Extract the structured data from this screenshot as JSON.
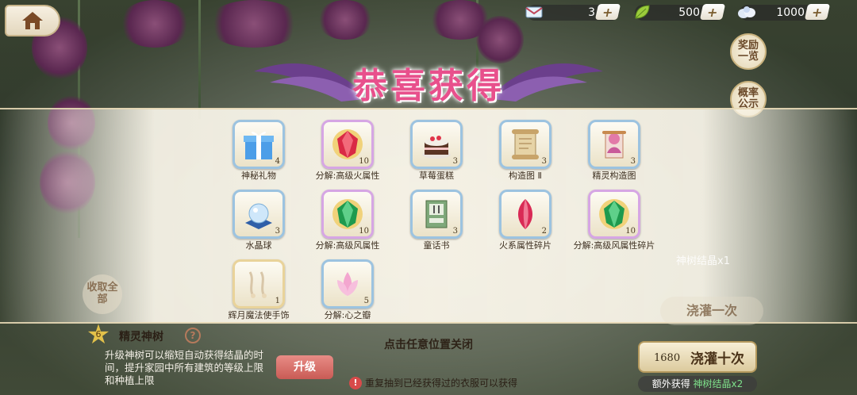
{
  "currencies": [
    {
      "icon": "letter-icon",
      "value": "3",
      "plus": "+"
    },
    {
      "icon": "leaf-icon",
      "value": "500",
      "plus": "+"
    },
    {
      "icon": "cloud-gem-icon",
      "value": "1000",
      "plus": "+"
    }
  ],
  "side_buttons": {
    "rewards": "奖励一览",
    "probability": "概率公示"
  },
  "title": "恭喜获得",
  "items": [
    {
      "name": "神秘礼物",
      "count": "4",
      "icon": "gift-box-icon",
      "frame": "blue"
    },
    {
      "name": "分解:高级火属性",
      "count": "10",
      "icon": "red-gem-icon",
      "frame": "purple"
    },
    {
      "name": "草莓蛋糕",
      "count": "3",
      "icon": "cake-icon",
      "frame": "blue"
    },
    {
      "name": "构造图 Ⅱ",
      "count": "3",
      "icon": "scroll-icon",
      "frame": "blue"
    },
    {
      "name": "精灵构造图",
      "count": "3",
      "icon": "fairy-scroll-icon",
      "frame": "blue"
    },
    {
      "name": "水晶球",
      "count": "3",
      "icon": "crystal-ball-icon",
      "frame": "blue"
    },
    {
      "name": "分解:高级风属性",
      "count": "10",
      "icon": "green-gem-icon",
      "frame": "purple"
    },
    {
      "name": "童话书",
      "count": "3",
      "icon": "storybook-icon",
      "frame": "blue"
    },
    {
      "name": "火系属性碎片",
      "count": "2",
      "icon": "red-shard-icon",
      "frame": "blue"
    },
    {
      "name": "分解:高级风属性碎片",
      "count": "10",
      "icon": "green-gem-icon",
      "frame": "purple"
    },
    {
      "name": "辉月魔法使手饰",
      "count": "1",
      "icon": "bracelet-icon",
      "frame": "gold"
    },
    {
      "name": "分解:心之瓣",
      "count": "5",
      "icon": "pink-lotus-icon",
      "frame": "blue"
    }
  ],
  "close_hint": "点击任意位置关闭",
  "bottom": {
    "collect_all": "收取全部",
    "level": "6",
    "tree_label": "精灵神树",
    "help": "?",
    "description": "升级神树可以缩短自动获得结晶的时间，提升家园中所有建筑的等级上限和种植上限",
    "upgrade": "升级",
    "warning": "重复抽到已经获得过的衣服可以获得"
  },
  "right_panel": {
    "crystal_line": "神树结晶x1",
    "water_once": "浇灌一次",
    "water_ten_cost": "1680",
    "water_ten": "浇灌十次",
    "extra_prefix": "额外获得",
    "extra_highlight": "神树结晶x2"
  }
}
